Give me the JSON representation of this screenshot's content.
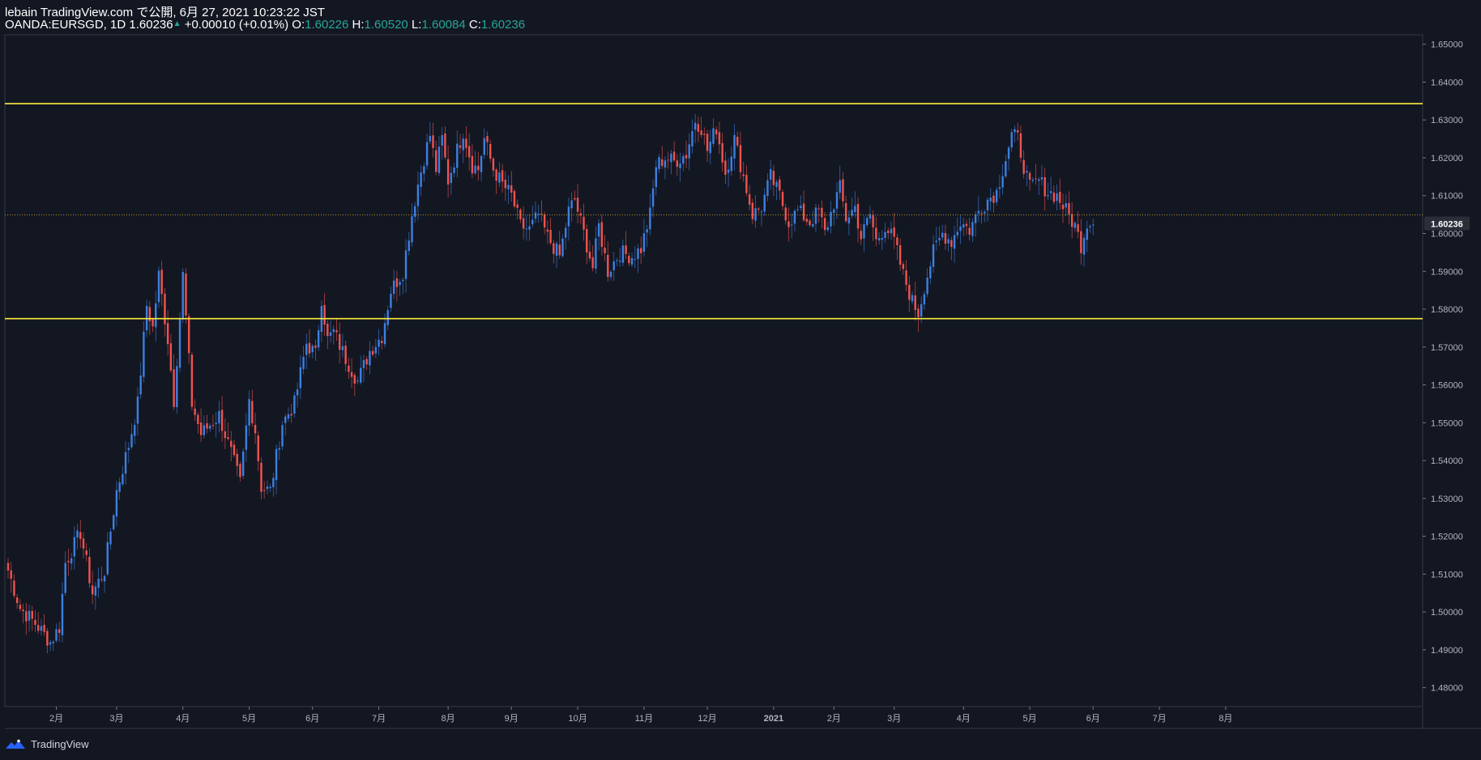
{
  "header": {
    "publisher": "lebain TradingView.com で公開, 6月 27, 2021 10:23:22 JST",
    "symbol": "OANDA:EURSGD, 1D",
    "last": "1.60236",
    "change": "+0.00010 (+0.01%)",
    "o_label": "O:",
    "o_value": "1.60226",
    "h_label": "H:",
    "h_value": "1.60520",
    "l_label": "L:",
    "l_value": "1.60084",
    "c_label": "C:",
    "c_value": "1.60236"
  },
  "footer": {
    "brand": "TradingView",
    "logo_icon": "tradingview-logo-icon"
  },
  "colors": {
    "background": "#131722",
    "up": "#2962ff",
    "up_bright": "#3d7fe0",
    "down": "#ef5350",
    "level_line": "#ffeb3b",
    "price_line": "#c9a227",
    "axis": "#b2b5be"
  },
  "chart_data": {
    "type": "candlestick",
    "symbol": "OANDA:EURSGD",
    "interval": "1D",
    "ylim": [
      1.475,
      1.6525
    ],
    "y_ticks": [
      "1.65000",
      "1.64000",
      "1.63000",
      "1.62000",
      "1.61000",
      "1.60000",
      "1.59000",
      "1.58000",
      "1.57000",
      "1.56000",
      "1.55000",
      "1.54000",
      "1.53000",
      "1.52000",
      "1.51000",
      "1.50000",
      "1.49000",
      "1.48000"
    ],
    "x_ticks": [
      {
        "label": "2月",
        "i": 16
      },
      {
        "label": "3月",
        "i": 36
      },
      {
        "label": "4月",
        "i": 58
      },
      {
        "label": "5月",
        "i": 80
      },
      {
        "label": "6月",
        "i": 101
      },
      {
        "label": "7月",
        "i": 123
      },
      {
        "label": "8月",
        "i": 146
      },
      {
        "label": "9月",
        "i": 167
      },
      {
        "label": "10月",
        "i": 189
      },
      {
        "label": "11月",
        "i": 211
      },
      {
        "label": "12月",
        "i": 232
      },
      {
        "label": "2021",
        "i": 254,
        "bold": true
      },
      {
        "label": "2月",
        "i": 274
      },
      {
        "label": "3月",
        "i": 294
      },
      {
        "label": "4月",
        "i": 317
      },
      {
        "label": "5月",
        "i": 339
      },
      {
        "label": "6月",
        "i": 360
      },
      {
        "label": "7月",
        "i": 382
      },
      {
        "label": "8月",
        "i": 404
      }
    ],
    "horizontal_levels": [
      1.6343,
      1.5775
    ],
    "last_price": 1.60236,
    "last_price_label": "1.60236",
    "waypoints": [
      [
        0,
        1.511
      ],
      [
        4,
        1.501
      ],
      [
        9,
        1.497
      ],
      [
        14,
        1.492
      ],
      [
        17,
        1.496
      ],
      [
        19,
        1.513
      ],
      [
        24,
        1.521
      ],
      [
        28,
        1.505
      ],
      [
        32,
        1.511
      ],
      [
        36,
        1.532
      ],
      [
        40,
        1.544
      ],
      [
        43,
        1.555
      ],
      [
        46,
        1.581
      ],
      [
        48,
        1.575
      ],
      [
        50,
        1.589
      ],
      [
        53,
        1.572
      ],
      [
        55,
        1.556
      ],
      [
        58,
        1.589
      ],
      [
        61,
        1.555
      ],
      [
        64,
        1.547
      ],
      [
        70,
        1.552
      ],
      [
        74,
        1.542
      ],
      [
        77,
        1.534
      ],
      [
        80,
        1.556
      ],
      [
        82,
        1.548
      ],
      [
        84,
        1.533
      ],
      [
        87,
        1.532
      ],
      [
        91,
        1.55
      ],
      [
        95,
        1.555
      ],
      [
        99,
        1.571
      ],
      [
        102,
        1.568
      ],
      [
        104,
        1.583
      ],
      [
        106,
        1.572
      ],
      [
        108,
        1.574
      ],
      [
        112,
        1.567
      ],
      [
        116,
        1.561
      ],
      [
        120,
        1.569
      ],
      [
        124,
        1.573
      ],
      [
        127,
        1.585
      ],
      [
        131,
        1.59
      ],
      [
        134,
        1.605
      ],
      [
        136,
        1.613
      ],
      [
        138,
        1.62
      ],
      [
        140,
        1.626
      ],
      [
        142,
        1.617
      ],
      [
        144,
        1.625
      ],
      [
        146,
        1.614
      ],
      [
        149,
        1.622
      ],
      [
        151,
        1.627
      ],
      [
        154,
        1.618
      ],
      [
        156,
        1.617
      ],
      [
        158,
        1.625
      ],
      [
        161,
        1.617
      ],
      [
        164,
        1.613
      ],
      [
        167,
        1.61
      ],
      [
        170,
        1.602
      ],
      [
        173,
        1.601
      ],
      [
        176,
        1.605
      ],
      [
        179,
        1.599
      ],
      [
        183,
        1.594
      ],
      [
        186,
        1.606
      ],
      [
        188,
        1.609
      ],
      [
        191,
        1.6
      ],
      [
        194,
        1.591
      ],
      [
        196,
        1.602
      ],
      [
        199,
        1.59
      ],
      [
        203,
        1.595
      ],
      [
        207,
        1.594
      ],
      [
        210,
        1.596
      ],
      [
        213,
        1.605
      ],
      [
        215,
        1.618
      ],
      [
        218,
        1.62
      ],
      [
        221,
        1.619
      ],
      [
        225,
        1.621
      ],
      [
        228,
        1.63
      ],
      [
        230,
        1.628
      ],
      [
        232,
        1.622
      ],
      [
        235,
        1.628
      ],
      [
        238,
        1.616
      ],
      [
        241,
        1.625
      ],
      [
        244,
        1.615
      ],
      [
        247,
        1.605
      ],
      [
        250,
        1.607
      ],
      [
        253,
        1.615
      ],
      [
        256,
        1.61
      ],
      [
        259,
        1.603
      ],
      [
        262,
        1.606
      ],
      [
        266,
        1.603
      ],
      [
        269,
        1.606
      ],
      [
        271,
        1.6
      ],
      [
        274,
        1.608
      ],
      [
        276,
        1.612
      ],
      [
        278,
        1.604
      ],
      [
        281,
        1.607
      ],
      [
        283,
        1.599
      ],
      [
        286,
        1.605
      ],
      [
        288,
        1.598
      ],
      [
        291,
        1.602
      ],
      [
        294,
        1.598
      ],
      [
        297,
        1.589
      ],
      [
        300,
        1.582
      ],
      [
        302,
        1.579
      ],
      [
        304,
        1.586
      ],
      [
        307,
        1.595
      ],
      [
        310,
        1.6
      ],
      [
        313,
        1.598
      ],
      [
        316,
        1.603
      ],
      [
        319,
        1.601
      ],
      [
        322,
        1.606
      ],
      [
        325,
        1.609
      ],
      [
        328,
        1.611
      ],
      [
        331,
        1.62
      ],
      [
        333,
        1.626
      ],
      [
        335,
        1.625
      ],
      [
        337,
        1.618
      ],
      [
        339,
        1.612
      ],
      [
        342,
        1.614
      ],
      [
        345,
        1.611
      ],
      [
        348,
        1.61
      ],
      [
        351,
        1.606
      ],
      [
        354,
        1.602
      ],
      [
        356,
        1.597
      ],
      [
        358,
        1.603
      ],
      [
        360,
        1.6024
      ]
    ]
  }
}
